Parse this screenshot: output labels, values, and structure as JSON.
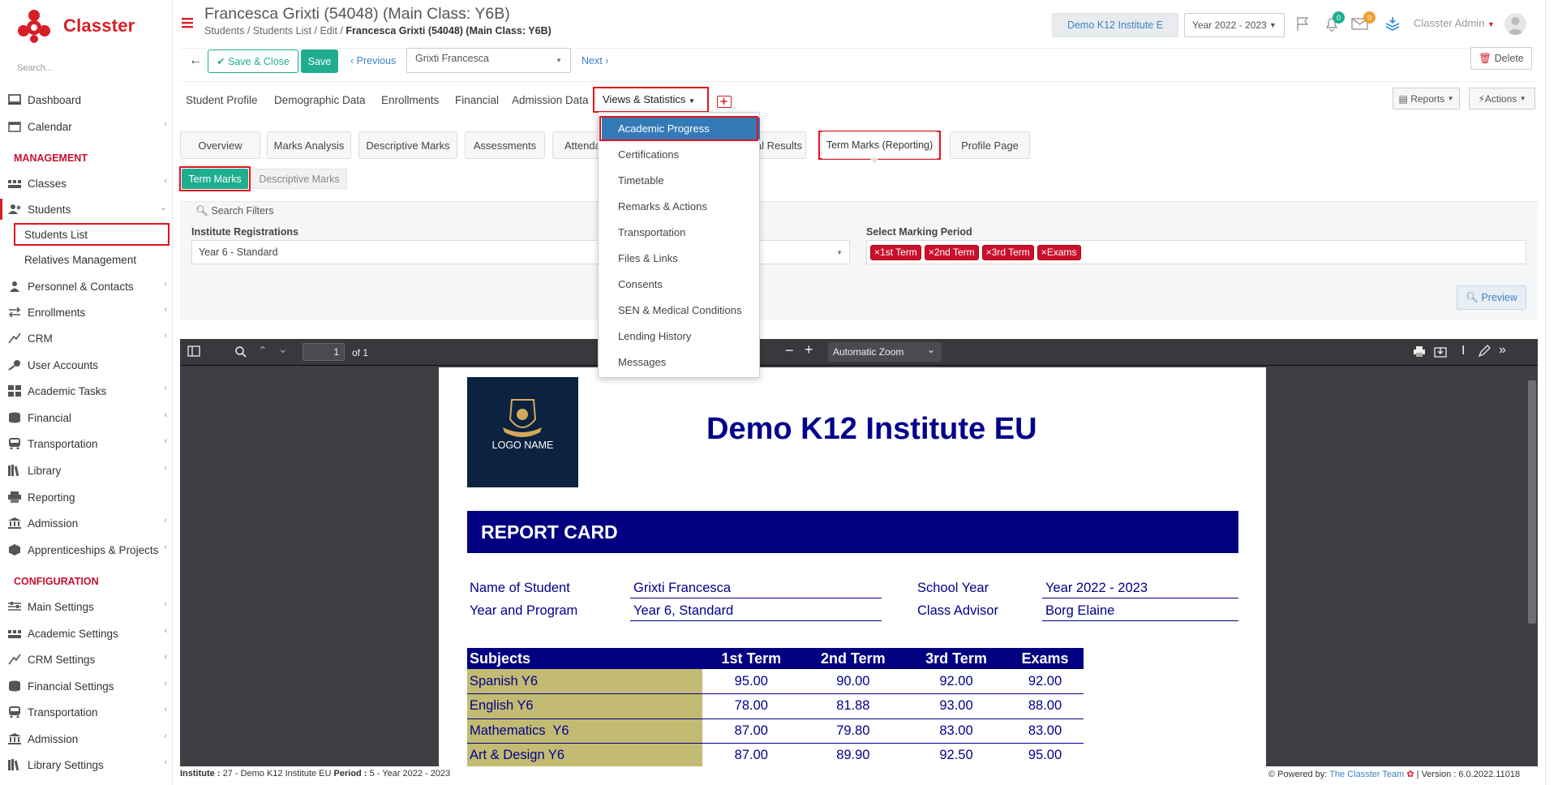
{
  "app": {
    "name": "Classter",
    "search_placeholder": "Search..."
  },
  "sidebar": {
    "items": [
      {
        "label": "Dashboard",
        "icon": "monitor-icon"
      },
      {
        "label": "Calendar",
        "icon": "calendar-icon"
      },
      {
        "label": "Classes",
        "icon": "classes-icon"
      },
      {
        "label": "Students",
        "icon": "students-icon"
      },
      {
        "label": "Personnel & Contacts",
        "icon": "person-icon"
      },
      {
        "label": "Enrollments",
        "icon": "arrows-icon"
      },
      {
        "label": "CRM",
        "icon": "crm-icon"
      },
      {
        "label": "User Accounts",
        "icon": "key-icon"
      },
      {
        "label": "Academic Tasks",
        "icon": "grid-icon"
      },
      {
        "label": "Financial",
        "icon": "coins-icon"
      },
      {
        "label": "Transportation",
        "icon": "bus-icon"
      },
      {
        "label": "Library",
        "icon": "books-icon"
      },
      {
        "label": "Reporting",
        "icon": "printer-icon"
      },
      {
        "label": "Admission",
        "icon": "bank-icon"
      },
      {
        "label": "Apprenticeships & Projects",
        "icon": "cube-icon"
      }
    ],
    "students_sub": [
      "Students List",
      "Relatives Management"
    ],
    "management_heading": "MANAGEMENT",
    "configuration_heading": "CONFIGURATION",
    "config_items": [
      {
        "label": "Main Settings",
        "icon": "sliders-icon"
      },
      {
        "label": "Academic Settings",
        "icon": "classes-icon"
      },
      {
        "label": "CRM Settings",
        "icon": "crm-icon"
      },
      {
        "label": "Financial Settings",
        "icon": "coins-icon"
      },
      {
        "label": "Transportation",
        "icon": "bus-icon"
      },
      {
        "label": "Admission",
        "icon": "bank-icon"
      },
      {
        "label": "Library Settings",
        "icon": "books-icon"
      }
    ]
  },
  "header": {
    "title": "Francesca Grixti (54048) (Main Class: Y6B)",
    "breadcrumb": [
      "Students",
      "Students List",
      "Edit"
    ],
    "breadcrumb_current": "Francesca Grixti (54048) (Main Class: Y6B)",
    "institute": "Demo K12 Institute E",
    "year": "Year 2022 - 2023",
    "notif_count": "0",
    "msg_count": "0",
    "user": "Classter Admin"
  },
  "toolbar": {
    "save_close": "Save & Close",
    "save": "Save",
    "previous": "Previous",
    "student_select": "Grixti Francesca",
    "next": "Next",
    "delete": "Delete"
  },
  "tabs": {
    "primary": [
      "Student Profile",
      "Demographic Data",
      "Enrollments",
      "Financial",
      "Admission Data",
      "Views & Statistics"
    ],
    "reports": "Reports",
    "actions": "Actions",
    "secondary": [
      "Overview",
      "Marks Analysis",
      "Descriptive Marks",
      "Assessments",
      "Attenda",
      "al Results",
      "Term Marks (Reporting)",
      "Profile Page"
    ],
    "tertiary": [
      "Term Marks",
      "Descriptive Marks"
    ]
  },
  "dropdown_menu": [
    "Academic Progress",
    "Certifications",
    "Timetable",
    "Remarks & Actions",
    "Transportation",
    "Files & Links",
    "Consents",
    "SEN & Medical Conditions",
    "Lending History",
    "Messages"
  ],
  "filters": {
    "heading": "Search Filters",
    "registrations_label": "Institute Registrations",
    "registrations_value": "Year 6 - Standard",
    "period_label": "Select Marking Period",
    "periods": [
      "1st Term",
      "2nd Term",
      "3rd Term",
      "Exams"
    ],
    "preview": "Preview"
  },
  "viewer": {
    "page_input": "1",
    "page_of": "of 1",
    "zoom": "Automatic Zoom"
  },
  "report": {
    "logo_text": "LOGO NAME",
    "institute": "Demo K12 Institute EU",
    "banner": "REPORT CARD",
    "name_label": "Name of Student",
    "name_value": "Grixti Francesca",
    "program_label": "Year and Program",
    "program_value": "Year 6, Standard",
    "year_label": "School Year",
    "year_value": "Year 2022 - 2023",
    "advisor_label": "Class Advisor",
    "advisor_value": "Borg Elaine",
    "columns": [
      "Subjects",
      "1st Term",
      "2nd Term",
      "3rd Term",
      "Exams"
    ],
    "rows": [
      [
        "Spanish Y6",
        "95.00",
        "90.00",
        "92.00",
        "92.00"
      ],
      [
        "English Y6",
        "78.00",
        "81.88",
        "93.00",
        "88.00"
      ],
      [
        "Mathematics  Y6",
        "87.00",
        "79.80",
        "83.00",
        "83.00"
      ],
      [
        "Art & Design Y6",
        "87.00",
        "89.90",
        "92.50",
        "95.00"
      ]
    ]
  },
  "footer": {
    "institute_label": "Institute :",
    "institute_value": "27 - Demo K12 Institute EU",
    "period_label": "Period :",
    "period_value": "5 - Year 2022 - 2023",
    "powered": "Powered by:",
    "team": "The Classter Team",
    "version": "Version : 6.0.2022.11018"
  },
  "colors": {
    "brand": "#d71f26",
    "save": "#1fad8f",
    "menu_active": "#337ab7",
    "report_navy": "#000080"
  }
}
